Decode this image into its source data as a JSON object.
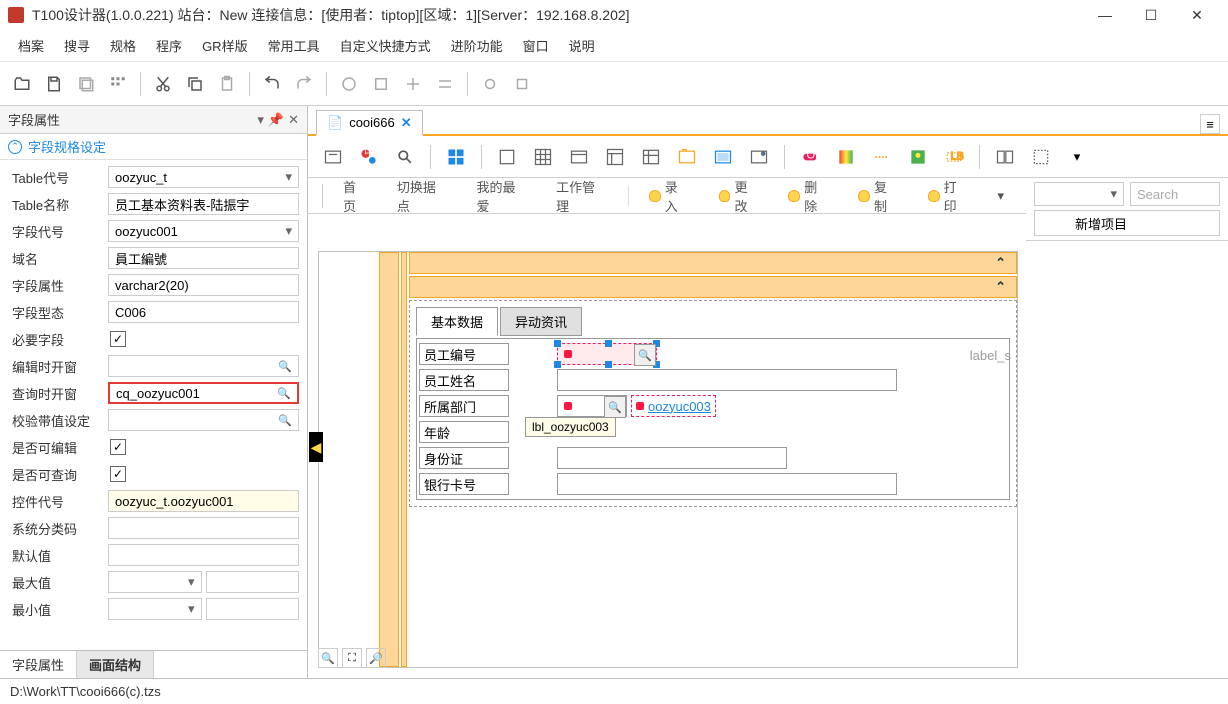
{
  "window": {
    "title": "T100设计器(1.0.0.221) 站台：New 连接信息：[使用者：tiptop][区域：1][Server：192.168.8.202]"
  },
  "menu": {
    "items": [
      "档案",
      "搜寻",
      "规格",
      "程序",
      "GR样版",
      "常用工具",
      "自定义快捷方式",
      "进阶功能",
      "窗口",
      "说明"
    ]
  },
  "panel": {
    "title": "字段属性",
    "section": "字段规格设定",
    "tabs": {
      "field_prop": "字段属性",
      "layout": "画面结构"
    },
    "rows": {
      "table_code": {
        "label": "Table代号",
        "value": "oozyuc_t"
      },
      "table_name": {
        "label": "Table名称",
        "value": "员工基本资料表-陆振宇"
      },
      "field_code": {
        "label": "字段代号",
        "value": "oozyuc001"
      },
      "domain": {
        "label": "域名",
        "value": "員工編號"
      },
      "field_attr": {
        "label": "字段属性",
        "value": "varchar2(20)"
      },
      "field_type": {
        "label": "字段型态",
        "value": "C006"
      },
      "required": {
        "label": "必要字段"
      },
      "edit_window": {
        "label": "编辑时开窗",
        "value": ""
      },
      "query_window": {
        "label": "查询时开窗",
        "value": "cq_oozyuc001"
      },
      "validate": {
        "label": "校验带值设定",
        "value": ""
      },
      "editable": {
        "label": "是否可编辑"
      },
      "queryable": {
        "label": "是否可查询"
      },
      "control_code": {
        "label": "控件代号",
        "value": "oozyuc_t.oozyuc001"
      },
      "sys_category": {
        "label": "系统分类码",
        "value": ""
      },
      "default_val": {
        "label": "默认值",
        "value": ""
      },
      "max_val": {
        "label": "最大值",
        "value": ""
      },
      "min_val": {
        "label": "最小值",
        "value": ""
      }
    }
  },
  "doc": {
    "tab_name": "cooi666"
  },
  "nav": {
    "home": "首页",
    "switch": "切换据点",
    "fav": "我的最爱",
    "work": "工作管理",
    "insert": "录入",
    "edit": "更改",
    "delete": "删除",
    "copy": "复制",
    "print": "打印",
    "search_placeholder": "Search",
    "add_item": "新增项目"
  },
  "form": {
    "tab_basic": "基本数据",
    "tab_change": "异动资讯",
    "fields": {
      "emp_no": "员工编号",
      "emp_name": "员工姓名",
      "dept": "所属部门",
      "age": "年龄",
      "id_card": "身份证",
      "bank_card": "银行卡号"
    },
    "extra_field": "oozyuc003",
    "tooltip": "lbl_oozyuc003",
    "label_s": "label_s"
  },
  "status": {
    "path": "D:\\Work\\TT\\cooi666(c).tzs"
  }
}
